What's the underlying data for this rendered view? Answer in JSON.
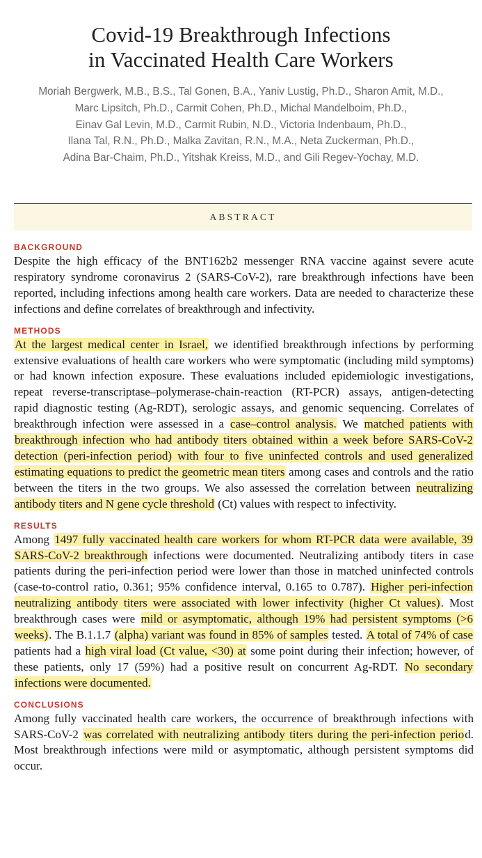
{
  "title_lines": [
    "Covid-19 Breakthrough Infections",
    "in Vaccinated Health Care Workers"
  ],
  "authors_lines": [
    "Moriah Bergwerk, M.B., B.S., Tal Gonen, B.A., Yaniv Lustig, Ph.D., Sharon Amit, M.D.,",
    "Marc Lipsitch, Ph.D., Carmit Cohen, Ph.D., Michal Mandelboim, Ph.D.,",
    "Einav Gal Levin, M.D., Carmit Rubin, N.D., Victoria Indenbaum, Ph.D.,",
    "Ilana Tal, R.N., Ph.D., Malka Zavitan, R.N., M.A., Neta Zuckerman, Ph.D.,",
    "Adina Bar-Chaim, Ph.D., Yitshak Kreiss, M.D., and Gili Regev-Yochay, M.D."
  ],
  "abstract_heading": "ABSTRACT",
  "highlight_color": "#fdf0a7",
  "label_color": "#c0392b",
  "sections": [
    {
      "label": "BACKGROUND",
      "segments": [
        {
          "text": "Despite the high efficacy of the BNT162b2 messenger RNA vaccine against severe acute respiratory syndrome coronavirus 2 (SARS-CoV-2), rare breakthrough infections have been reported, including infections among health care workers. Data are needed to characterize these infections and define correlates of breakthrough and infectivity.",
          "hl": false
        }
      ]
    },
    {
      "label": "METHODS",
      "segments": [
        {
          "text": "At the largest medical center in Israel,",
          "hl": true
        },
        {
          "text": " we identified breakthrough infections by performing extensive evaluations of health care workers who were symptomatic (including mild symptoms) or had known infection exposure. These evaluations included epidemiologic investigations, repeat reverse-transcriptase–polymerase-chain-reaction (RT-PCR) assays, antigen-detecting rapid diagnostic testing (Ag-RDT), serologic assays, and genomic sequencing. Correlates of breakthrough infection were assessed in a ",
          "hl": false
        },
        {
          "text": "case–control analysis.",
          "hl": true
        },
        {
          "text": " We ",
          "hl": false
        },
        {
          "text": "matched patients with breakthrough infection who had antibody titers obtained within a week before SARS-CoV-2 detection (peri-infection period) with four to five uninfected controls and used generalized estimating equations to predict the geometric mean titers",
          "hl": true
        },
        {
          "text": " among cases and controls and the ratio between the titers in the two groups. We also assessed the correlation between ",
          "hl": false
        },
        {
          "text": "neutralizing antibody titers and N gene cycle threshold",
          "hl": true
        },
        {
          "text": " (Ct) values with respect to infectivity.",
          "hl": false
        }
      ]
    },
    {
      "label": "RESULTS",
      "segments": [
        {
          "text": "Among ",
          "hl": false
        },
        {
          "text": "1497 fully vaccinated health care workers for whom RT-PCR data were available, 39 SARS-CoV-2 breakthrough",
          "hl": true
        },
        {
          "text": " infections were documented. Neutralizing antibody titers in case patients during the peri-infection period were lower than those in matched uninfected controls (case-to-control ratio, 0.361; 95% confidence interval, 0.165 to 0.787). ",
          "hl": false
        },
        {
          "text": "Higher peri-infection neutralizing antibody titers were associated with lower infectivity (higher Ct values)",
          "hl": true
        },
        {
          "text": ". Most breakthrough cases were ",
          "hl": false
        },
        {
          "text": "mild or asymptomatic, although 19% had persistent symptoms (>6 weeks)",
          "hl": true
        },
        {
          "text": ". The B.1.1.7 ",
          "hl": false
        },
        {
          "text": "(alpha) variant was found in 85% of samples",
          "hl": true
        },
        {
          "text": " tested. ",
          "hl": false
        },
        {
          "text": "A total of 74% of case",
          "hl": true
        },
        {
          "text": " patients had a ",
          "hl": false
        },
        {
          "text": "high viral load (Ct value, <30) at",
          "hl": true
        },
        {
          "text": " some point during their infection; however, of these patients, only 17 (59%) had a positive result on concurrent Ag-RDT. ",
          "hl": false
        },
        {
          "text": "No secondary infections were documented.",
          "hl": true
        }
      ]
    },
    {
      "label": "CONCLUSIONS",
      "segments": [
        {
          "text": "Among fully vaccinated health care workers, the occurrence of breakthrough infections with SARS-CoV-2 ",
          "hl": false
        },
        {
          "text": "was correlated with neutralizing antibody titers during the peri-infection perio",
          "hl": true
        },
        {
          "text": "d. Most breakthrough infections were mild or asymptomatic, although persistent symptoms did occur.",
          "hl": false
        }
      ]
    }
  ]
}
